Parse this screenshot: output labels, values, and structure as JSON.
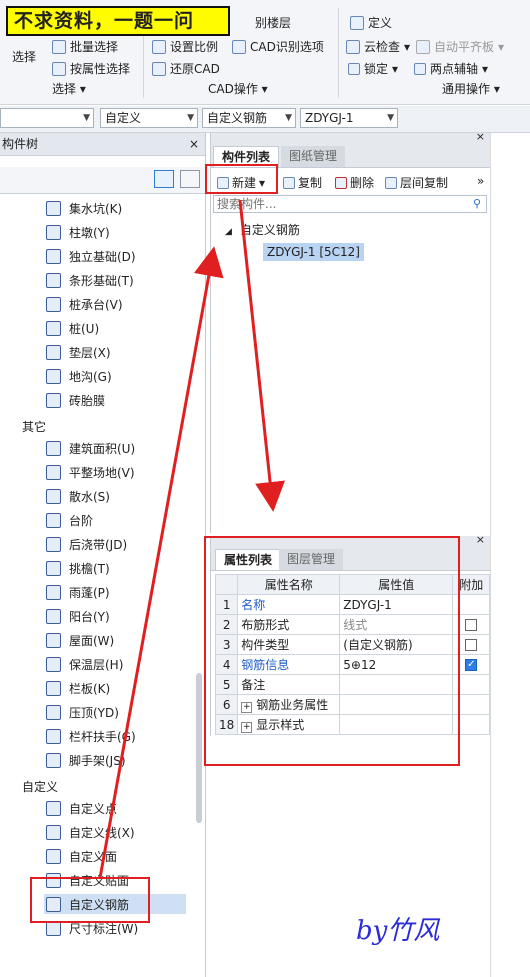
{
  "banner": {
    "text": "不求资料，一题一问"
  },
  "ribbon": {
    "select_label": "选择",
    "batch_select": "批量选择",
    "attr_select": "按属性选择",
    "group_select": "选择",
    "identify_fragment": "别楼层",
    "set_scale": "设置比例",
    "cad_identify": "CAD识别选项",
    "restore_cad": "还原CAD",
    "group_cad": "CAD操作",
    "define": "定义",
    "cloud_check": "云检查",
    "auto_align": "自动平齐板",
    "lock": "锁定",
    "two_point_axis": "两点辅轴",
    "group_general": "通用操作"
  },
  "selectors": [
    "",
    "自定义",
    "自定义钢筋",
    "ZDYGJ-1"
  ],
  "left_panel": {
    "header": "构件树",
    "items_a": [
      "集水坑(K)",
      "柱墩(Y)",
      "独立基础(D)",
      "条形基础(T)",
      "桩承台(V)",
      "桩(U)",
      "垫层(X)",
      "地沟(G)",
      "砖胎膜"
    ],
    "category_other": "其它",
    "items_b": [
      "建筑面积(U)",
      "平整场地(V)",
      "散水(S)",
      "台阶",
      "后浇带(JD)",
      "挑檐(T)",
      "雨蓬(P)",
      "阳台(Y)",
      "屋面(W)",
      "保温层(H)",
      "栏板(K)",
      "压顶(YD)",
      "栏杆扶手(G)",
      "脚手架(JS)"
    ],
    "category_custom": "自定义",
    "items_c": [
      "自定义点",
      "自定义线(X)",
      "自定义面",
      "自定义贴面",
      "自定义钢筋",
      "尺寸标注(W)"
    ]
  },
  "component_panel": {
    "tab_active": "构件列表",
    "tab_inactive": "图纸管理",
    "new": "新建",
    "copy": "复制",
    "delete": "删除",
    "floor_copy": "层间复制",
    "search_placeholder": "搜索构件...",
    "tree_root": "自定义钢筋",
    "tree_child": "ZDYGJ-1 [5C12]"
  },
  "property_panel": {
    "tab_active": "属性列表",
    "tab_inactive": "图层管理",
    "col_name": "属性名称",
    "col_value": "属性值",
    "col_extra": "附加",
    "rows": [
      {
        "num": "1",
        "name": "名称",
        "value": "ZDYGJ-1"
      },
      {
        "num": "2",
        "name": "布筋形式",
        "value": "线式"
      },
      {
        "num": "3",
        "name": "构件类型",
        "value": "(自定义钢筋)"
      },
      {
        "num": "4",
        "name": "钢筋信息",
        "value": "5⊕12"
      },
      {
        "num": "5",
        "name": "备注",
        "value": ""
      },
      {
        "num": "6",
        "name": "钢筋业务属性",
        "value": ""
      },
      {
        "num": "18",
        "name": "显示样式",
        "value": ""
      }
    ]
  },
  "signature": "by竹风"
}
